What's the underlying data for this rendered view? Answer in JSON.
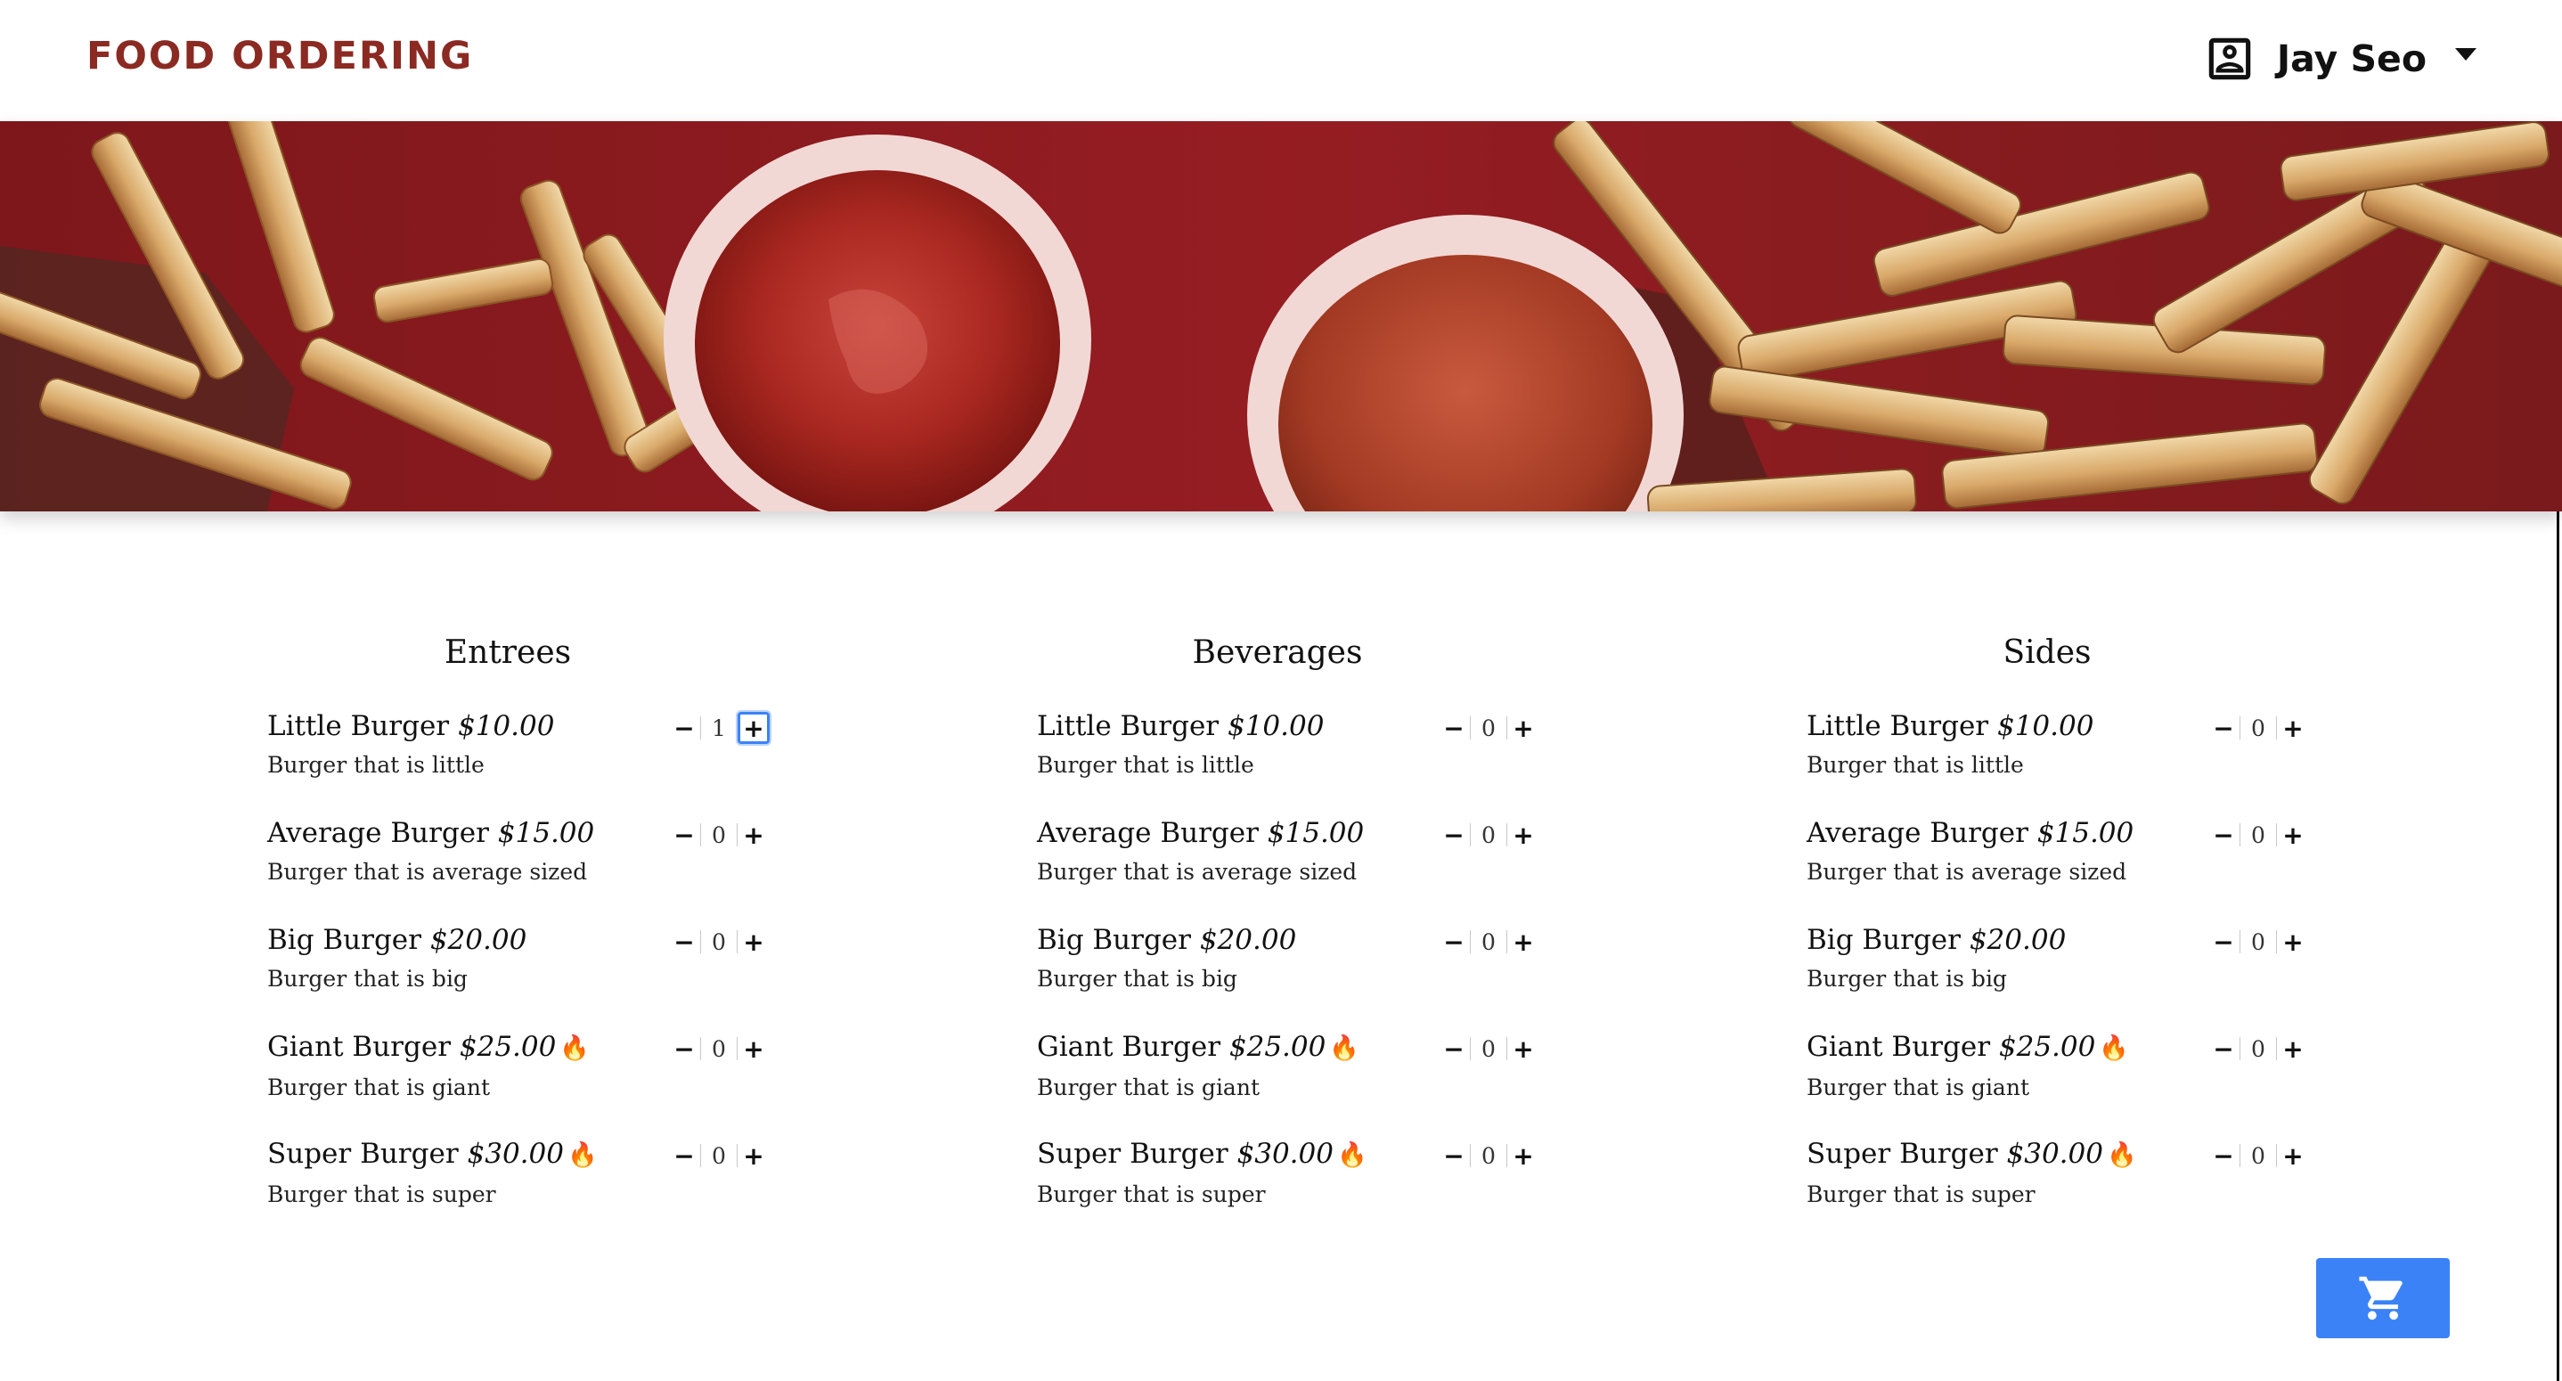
{
  "header": {
    "brand": "FOOD ORDERING",
    "user_name": "Jay Seo",
    "user_icon": "account-box-icon",
    "dropdown_icon": "caret-down-icon"
  },
  "banner": {
    "image": "fries-and-dipping-sauces-photo"
  },
  "colors": {
    "brand": "#8b2a22",
    "accent": "#3b82f6",
    "banner_bg": "#8e1c20"
  },
  "menu": {
    "columns": [
      {
        "title": "Entrees",
        "items": [
          {
            "name": "Little Burger",
            "price": "$10.00",
            "desc": "Burger that is little",
            "qty": "1",
            "spicy": false
          },
          {
            "name": "Average Burger",
            "price": "$15.00",
            "desc": "Burger that is average sized",
            "qty": "0",
            "spicy": false
          },
          {
            "name": "Big Burger",
            "price": "$20.00",
            "desc": "Burger that is big",
            "qty": "0",
            "spicy": false
          },
          {
            "name": "Giant Burger",
            "price": "$25.00",
            "desc": "Burger that is giant",
            "qty": "0",
            "spicy": true
          },
          {
            "name": "Super Burger",
            "price": "$30.00",
            "desc": "Burger that is super",
            "qty": "0",
            "spicy": true
          }
        ]
      },
      {
        "title": "Beverages",
        "items": [
          {
            "name": "Little Burger",
            "price": "$10.00",
            "desc": "Burger that is little",
            "qty": "0",
            "spicy": false
          },
          {
            "name": "Average Burger",
            "price": "$15.00",
            "desc": "Burger that is average sized",
            "qty": "0",
            "spicy": false
          },
          {
            "name": "Big Burger",
            "price": "$20.00",
            "desc": "Burger that is big",
            "qty": "0",
            "spicy": false
          },
          {
            "name": "Giant Burger",
            "price": "$25.00",
            "desc": "Burger that is giant",
            "qty": "0",
            "spicy": true
          },
          {
            "name": "Super Burger",
            "price": "$30.00",
            "desc": "Burger that is super",
            "qty": "0",
            "spicy": true
          }
        ]
      },
      {
        "title": "Sides",
        "items": [
          {
            "name": "Little Burger",
            "price": "$10.00",
            "desc": "Burger that is little",
            "qty": "0",
            "spicy": false
          },
          {
            "name": "Average Burger",
            "price": "$15.00",
            "desc": "Burger that is average sized",
            "qty": "0",
            "spicy": false
          },
          {
            "name": "Big Burger",
            "price": "$20.00",
            "desc": "Burger that is big",
            "qty": "0",
            "spicy": false
          },
          {
            "name": "Giant Burger",
            "price": "$25.00",
            "desc": "Burger that is giant",
            "qty": "0",
            "spicy": true
          },
          {
            "name": "Super Burger",
            "price": "$30.00",
            "desc": "Burger that is super",
            "qty": "0",
            "spicy": true
          }
        ]
      }
    ],
    "decrement_symbol": "−",
    "increment_symbol": "+",
    "spicy_symbol": "🔥",
    "spicy_icon": "fire-icon",
    "focused_control": "Entrees / Little Burger increment"
  },
  "cart": {
    "icon": "shopping-cart-icon"
  }
}
